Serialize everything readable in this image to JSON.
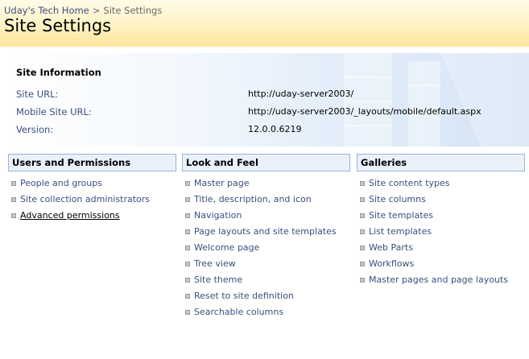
{
  "breadcrumb": {
    "home": "Uday's Tech Home",
    "separator": ">",
    "current": "Site Settings"
  },
  "page_title": "Site Settings",
  "site_information": {
    "title": "Site Information",
    "rows": [
      {
        "label": "Site URL:",
        "value": "http://uday-server2003/"
      },
      {
        "label": "Mobile Site URL:",
        "value": "http://uday-server2003/_layouts/mobile/default.aspx"
      },
      {
        "label": "Version:",
        "value": "12.0.0.6219"
      }
    ]
  },
  "sections": [
    {
      "title": "Users and Permissions",
      "items": [
        {
          "label": "People and groups"
        },
        {
          "label": "Site collection administrators"
        },
        {
          "label": "Advanced permissions"
        }
      ]
    },
    {
      "title": "Look and Feel",
      "items": [
        {
          "label": "Master page"
        },
        {
          "label": "Title, description, and icon"
        },
        {
          "label": "Navigation"
        },
        {
          "label": "Page layouts and site templates"
        },
        {
          "label": "Welcome page"
        },
        {
          "label": "Tree view"
        },
        {
          "label": "Site theme"
        },
        {
          "label": "Reset to site definition"
        },
        {
          "label": "Searchable columns"
        }
      ]
    },
    {
      "title": "Galleries",
      "items": [
        {
          "label": "Site content types"
        },
        {
          "label": "Site columns"
        },
        {
          "label": "Site templates"
        },
        {
          "label": "List templates"
        },
        {
          "label": "Web Parts"
        },
        {
          "label": "Workflows"
        },
        {
          "label": "Master pages and page layouts"
        }
      ]
    }
  ],
  "colors": {
    "link": "#3b4f7d",
    "section_border": "#95b7d9",
    "section_header_bg": "#eaf1fa",
    "header_gradient_end": "#fde49a"
  }
}
